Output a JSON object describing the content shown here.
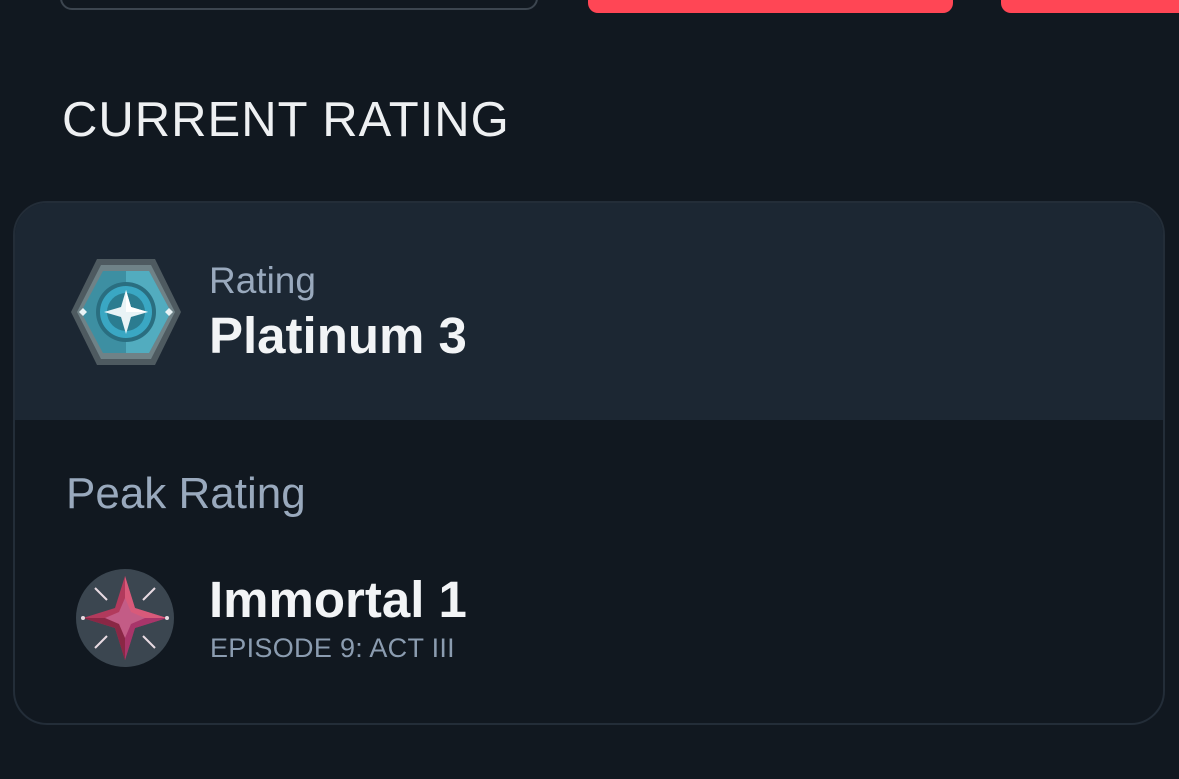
{
  "section": {
    "title": "CURRENT RATING"
  },
  "current": {
    "label": "Rating",
    "value": "Platinum 3",
    "icon": "platinum-rank-icon"
  },
  "peak": {
    "label": "Peak Rating",
    "value": "Immortal 1",
    "episode": "EPISODE 9: ACT III",
    "icon": "immortal-rank-icon"
  },
  "colors": {
    "background": "#111820",
    "card_top": "#1c2733",
    "accent": "#ff4655",
    "muted_text": "#99a9bd",
    "primary_text": "#f2f4f6"
  }
}
